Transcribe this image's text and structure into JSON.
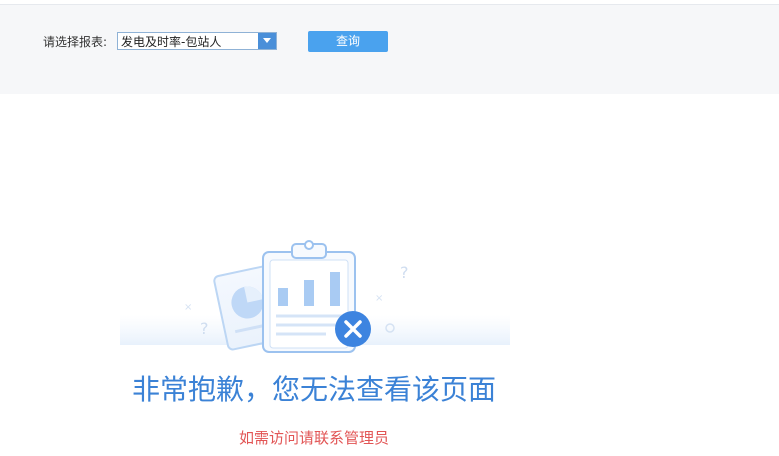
{
  "filter": {
    "label": "请选择报表:",
    "selected_report": "发电及时率-包站人",
    "query_label": "查询"
  },
  "error": {
    "title": "非常抱歉，您无法查看该页面",
    "subtitle": "如需访问请联系管理员"
  },
  "colors": {
    "accent": "#4aa2ee",
    "title": "#3b82d6",
    "subtitle": "#e25555",
    "bar_bg": "#f6f7f9"
  },
  "icons": {
    "select_arrow": "chevron-down-icon",
    "illustration": "forbidden-report-illustration",
    "error_badge": "close-circle-icon"
  }
}
